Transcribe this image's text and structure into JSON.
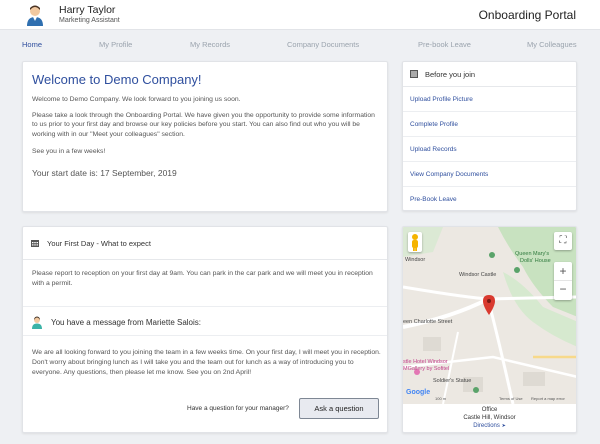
{
  "header": {
    "user_name": "Harry Taylor",
    "user_role": "Marketing Assistant",
    "portal_title": "Onboarding Portal"
  },
  "nav": {
    "items": [
      "Home",
      "My Profile",
      "My Records",
      "Company Documents",
      "Pre-book Leave",
      "My Colleagues"
    ],
    "active": "Home"
  },
  "welcome": {
    "title": "Welcome to Demo Company!",
    "p1": "Welcome to Demo Company. We look forward to you joining us soon.",
    "p2": "Please take a look through the Onboarding Portal. We have given you the opportunity to provide some information to us prior to your first day and browse our key policies before you start. You can also find out who you will be working with in our \"Meet your colleagues\" section.",
    "p3": "See you in a few weeks!",
    "start_date": "Your start date is: 17 September, 2019"
  },
  "before_join": {
    "title": "Before you join",
    "links": [
      "Upload Profile Picture",
      "Complete Profile",
      "Upload Records",
      "View Company Documents",
      "Pre-Book Leave"
    ]
  },
  "first_day": {
    "title": "Your First Day - What to expect",
    "body": "Please report to reception on your first day at 9am. You can park in the car park and we will meet you in reception with a permit.",
    "message_header": "You have a message from Mariette Salois:",
    "message_body": "We are all looking forward to you joining the team in a few weeks time. On your first day, I will meet you in reception. Don't worry about bringing lunch as I will take you and the team out for lunch as a way of introducing you to everyone. Any questions, then please let me know. See you on 2nd April!",
    "question_label": "Have a question for your manager?",
    "ask_button": "Ask a question"
  },
  "map": {
    "labels": {
      "windsor": "Windsor",
      "queen_marys": "Queen Mary's",
      "dolls_house": "Dolls' House",
      "windsor_castle": "Windsor Castle",
      "queen_charlotte": "een Charlotte Street",
      "castle_hotel": "stle Hotel Windsor",
      "mgallery": "MGallery by Sofitel",
      "soldiers_statue": "Soldier's Statue",
      "google": "Google",
      "scale": "100 m",
      "terms": "Terms of Use",
      "report": "Report a map error"
    },
    "office_label": "Office",
    "address": "Castle Hill, Windsor",
    "directions": "Directions"
  }
}
